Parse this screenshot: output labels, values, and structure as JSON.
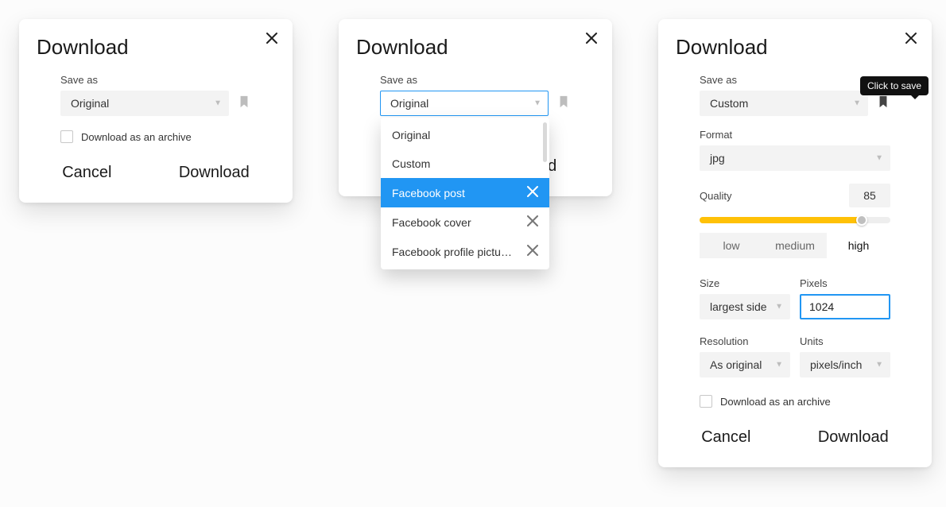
{
  "common": {
    "title": "Download",
    "save_as_label": "Save as",
    "archive_label": "Download as an archive",
    "cancel": "Cancel",
    "download": "Download"
  },
  "m1": {
    "save_as_value": "Original"
  },
  "m2": {
    "save_as_value": "Original",
    "options": [
      {
        "label": "Original",
        "deletable": false,
        "selected": false
      },
      {
        "label": "Custom",
        "deletable": false,
        "selected": false
      },
      {
        "label": "Facebook post",
        "deletable": true,
        "selected": true
      },
      {
        "label": "Facebook cover",
        "deletable": true,
        "selected": false
      },
      {
        "label": "Facebook profile pictu…",
        "deletable": true,
        "selected": false
      }
    ]
  },
  "m3": {
    "tooltip": "Click to save",
    "save_as_value": "Custom",
    "format_label": "Format",
    "format_value": "jpg",
    "quality_label": "Quality",
    "quality_value": "85",
    "quality_percent": 85,
    "quality_presets": {
      "low": "low",
      "medium": "medium",
      "high": "high",
      "active": "high"
    },
    "size_label": "Size",
    "size_value": "largest side",
    "pixels_label": "Pixels",
    "pixels_value": "1024",
    "resolution_label": "Resolution",
    "resolution_value": "As original",
    "units_label": "Units",
    "units_value": "pixels/inch"
  },
  "colors": {
    "accent_blue": "#2196f3",
    "accent_yellow": "#ffc107"
  }
}
